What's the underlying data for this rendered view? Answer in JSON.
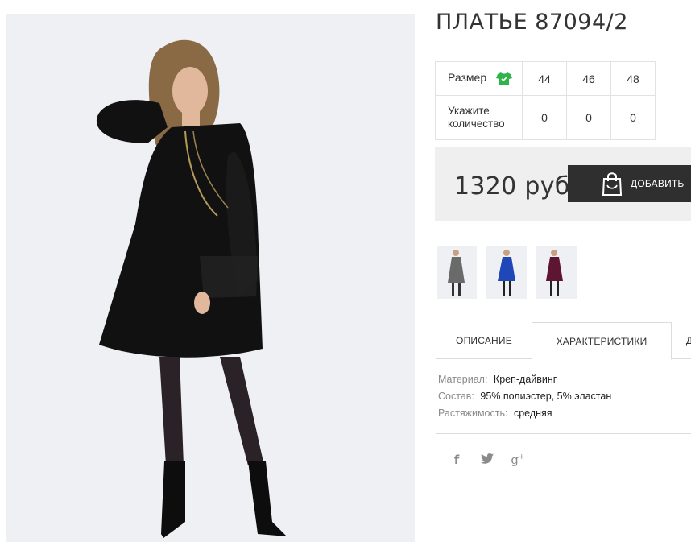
{
  "product": {
    "title": "ПЛАТЬЕ 87094/2"
  },
  "size_table": {
    "size_label": "Размер",
    "quantity_label_line1": "Укажите",
    "quantity_label_line2": "количество",
    "size_icon": "tshirt-icon",
    "sizes": [
      "44",
      "46",
      "48"
    ],
    "quantities": [
      "0",
      "0",
      "0"
    ]
  },
  "purchase": {
    "price": "1320 руб",
    "add_button_label": "ДОБАВИТЬ",
    "add_button_icon": "shopping-bag-icon"
  },
  "thumbnails": [
    {
      "name": "thumb-gray-dress",
      "color": "#6a6a6a"
    },
    {
      "name": "thumb-blue-dress",
      "color": "#1f47b8"
    },
    {
      "name": "thumb-burgundy-dress",
      "color": "#5e1630"
    }
  ],
  "tabs": {
    "description": "ОПИСАНИЕ",
    "characteristics": "ХАРАКТЕРИСТИКИ",
    "more": "Д"
  },
  "specs": [
    {
      "key": "Материал:",
      "value": "Креп-дайвинг"
    },
    {
      "key": "Состав:",
      "value": "95% полиэстер, 5% эластан"
    },
    {
      "key": "Растяжимость:",
      "value": "средняя"
    }
  ],
  "social": [
    {
      "icon": "facebook-icon",
      "glyph": "f"
    },
    {
      "icon": "twitter-icon",
      "glyph": "t"
    },
    {
      "icon": "google-plus-icon",
      "glyph": "g+"
    }
  ],
  "colors": {
    "accent_green": "#2fb34a",
    "button_dark": "#2f2f2f",
    "price_bg": "#efefef"
  }
}
